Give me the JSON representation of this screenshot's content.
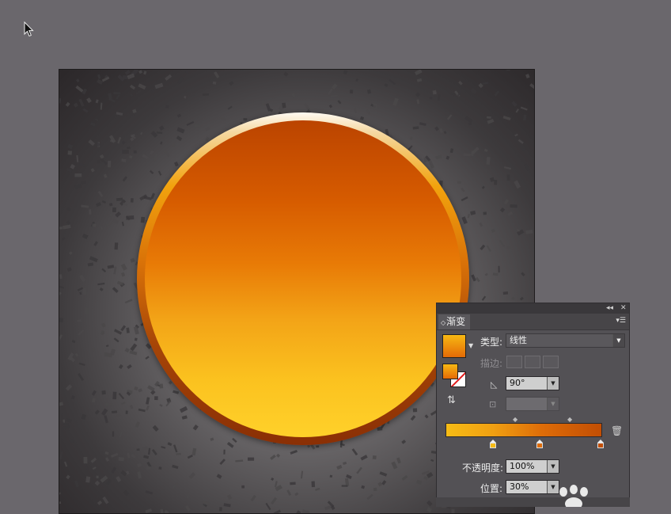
{
  "panel": {
    "tab_label": "渐变",
    "type_label": "类型:",
    "type_value": "线性",
    "stroke_label": "描边:",
    "angle_value": "90°",
    "aspect_value": "",
    "opacity_label": "不透明度:",
    "opacity_value": "100%",
    "location_label": "位置:",
    "location_value": "30%",
    "collapse_glyph": "◂◂",
    "close_glyph": "✕"
  },
  "gradient": {
    "type": "linear",
    "angle_deg": 90,
    "stop_colors": [
      "#f7bc15",
      "#de6c08",
      "#c24e04"
    ]
  },
  "colors": {
    "canvas_bg": "#6a676c",
    "panel_bg": "#535155",
    "ring_orange": "#f2a30e",
    "disc_top": "#bb4400",
    "disc_bottom": "#ffd12a"
  },
  "icons": [
    "cursor-arrow-icon",
    "swatch-dropdown-icon",
    "reverse-gradient-icon",
    "angle-icon",
    "aspect-ratio-icon",
    "delete-stop-icon",
    "panel-menu-icon",
    "paw-watermark-icon"
  ]
}
